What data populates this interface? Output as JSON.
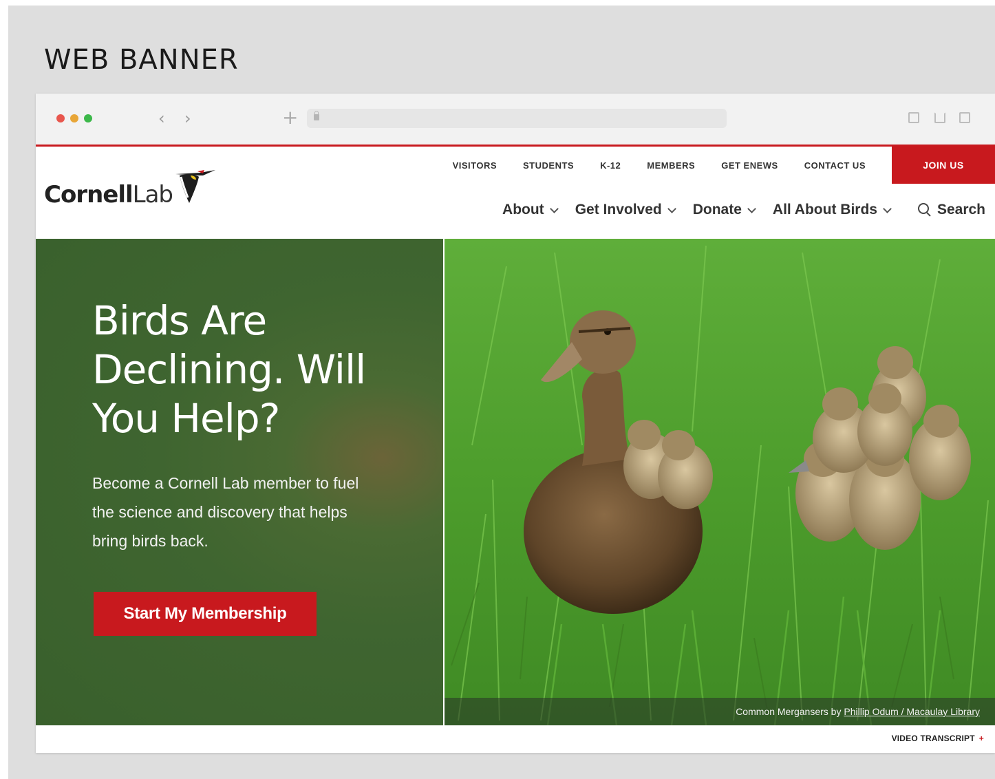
{
  "page_heading": "WEB BANNER",
  "browser": {
    "back_glyph": "‹",
    "forward_glyph": "›",
    "new_tab_glyph": "+",
    "window_controls": [
      "close",
      "minimize",
      "maximize"
    ],
    "right_icons": [
      "sidebar-icon",
      "share-icon",
      "tabs-icon"
    ]
  },
  "site": {
    "logo": {
      "bold": "Cornell",
      "light": "Lab"
    },
    "utility_nav": [
      "VISITORS",
      "STUDENTS",
      "K-12",
      "MEMBERS",
      "GET ENEWS",
      "CONTACT US"
    ],
    "join_label": "JOIN US",
    "main_nav": [
      "About",
      "Get Involved",
      "Donate",
      "All About Birds"
    ],
    "search_label": "Search",
    "accent_color": "#c8191e"
  },
  "hero": {
    "title": "Birds Are Declining. Will You Help?",
    "body": "Become a Cornell Lab member to fuel the science and discovery that helps bring birds back.",
    "cta_label": "Start My Membership",
    "caption_prefix": "Common Mergansers by",
    "caption_link": "Phillip Odum / Macaulay Library"
  },
  "footer": {
    "transcript_label": "VIDEO TRANSCRIPT",
    "transcript_glyph": "+"
  }
}
